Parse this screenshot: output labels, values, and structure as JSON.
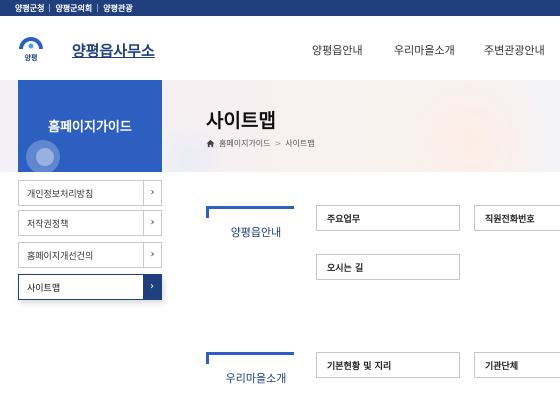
{
  "topbar": {
    "links": [
      "양평군청",
      "양평군의회",
      "양평관광"
    ]
  },
  "header": {
    "logo_text": "양평",
    "site_title": "양평읍사무소",
    "gnb": [
      "양평읍안내",
      "우리마을소개",
      "주변관광안내"
    ]
  },
  "side": {
    "title": "홈페이지가이드",
    "menu": [
      {
        "label": "개인정보처리방침"
      },
      {
        "label": "저작권정책"
      },
      {
        "label": "홈페이지개선건의"
      },
      {
        "label": "사이트맵"
      }
    ],
    "active_index": 3
  },
  "page": {
    "title": "사이트맵",
    "breadcrumb": [
      "홈페이지가이드",
      "사이트맵"
    ]
  },
  "sections": [
    {
      "heading": "양평읍안내",
      "items": [
        "주요업무",
        "직원전화번호",
        "오시는 길"
      ]
    },
    {
      "heading": "우리마을소개",
      "items": [
        "기본현황 및 지리",
        "기관단체"
      ]
    }
  ],
  "colors": {
    "primary": "#1f3f7d",
    "accent": "#2c5fc0"
  }
}
